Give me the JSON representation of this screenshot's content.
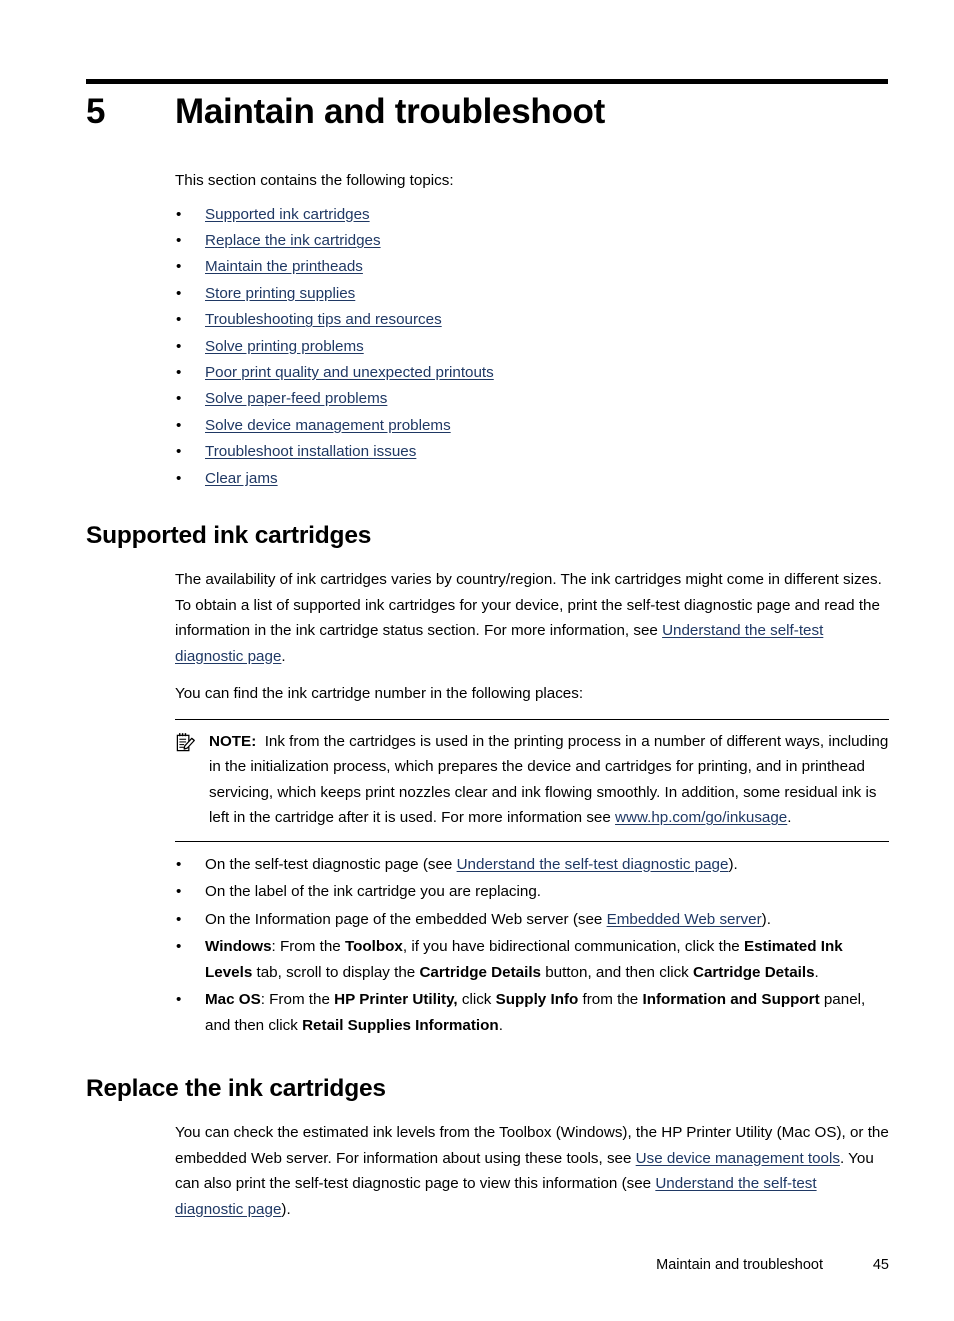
{
  "chapter": {
    "number": "5",
    "title": "Maintain and troubleshoot",
    "intro": "This section contains the following topics:"
  },
  "toc": {
    "bullet": "•",
    "items": [
      {
        "label": "Supported ink cartridges"
      },
      {
        "label": "Replace the ink cartridges"
      },
      {
        "label": "Maintain the printheads"
      },
      {
        "label": "Store printing supplies"
      },
      {
        "label": "Troubleshooting tips and resources"
      },
      {
        "label": "Solve printing problems"
      },
      {
        "label": "Poor print quality and unexpected printouts"
      },
      {
        "label": "Solve paper-feed problems"
      },
      {
        "label": "Solve device management problems"
      },
      {
        "label": "Troubleshoot installation issues"
      },
      {
        "label": "Clear jams"
      }
    ]
  },
  "section_supported": {
    "heading": "Supported ink cartridges",
    "para1_before": "The availability of ink cartridges varies by country/region. The ink cartridges might come in different sizes. To obtain a list of supported ink cartridges for your device, print the self-test diagnostic page and read the information in the ink cartridge status section. For more information, see ",
    "para1_link": "Understand the self-test diagnostic page",
    "para1_after": ".",
    "para2": "You can find the ink cartridge number in the following places:",
    "note": {
      "icon": "note-pencil-icon",
      "label": "NOTE:",
      "text_before": "Ink from the cartridges is used in the printing process in a number of different ways, including in the initialization process, which prepares the device and cartridges for printing, and in printhead servicing, which keeps print nozzles clear and ink flowing smoothly. In addition, some residual ink is left in the cartridge after it is used. For more information see ",
      "link": "www.hp.com/go/inkusage",
      "text_after": "."
    },
    "places": [
      {
        "seg1": "On the self-test diagnostic page (see ",
        "link": "Understand the self-test diagnostic page",
        "seg2": ")."
      },
      {
        "seg1": "On the label of the ink cartridge you are replacing.",
        "link": "",
        "seg2": ""
      },
      {
        "seg1": "On the Information page of the embedded Web server (see ",
        "link": "Embedded Web server",
        "seg2": ")."
      }
    ],
    "windows_bullet": {
      "b1": "Windows",
      "t1": ": From the ",
      "b2": "Toolbox",
      "t2": ", if you have bidirectional communication, click the ",
      "b3": "Estimated Ink Levels",
      "t3": " tab, scroll to display the ",
      "b4": "Cartridge Details",
      "t4": " button, and then click ",
      "b5": "Cartridge Details",
      "t5": "."
    },
    "mac_bullet": {
      "b1": "Mac OS",
      "t1": ": From the ",
      "b2": "HP Printer Utility,",
      "t2": " click ",
      "b3": "Supply Info",
      "t3": " from the ",
      "b4": "Information and Support",
      "t4": " panel, and then click ",
      "b5": "Retail Supplies Information",
      "t5": "."
    }
  },
  "section_replace": {
    "heading": "Replace the ink cartridges",
    "para_seg1": "You can check the estimated ink levels from the Toolbox (Windows), the HP Printer Utility (Mac OS), or the embedded Web server. For information about using these tools, see ",
    "para_link1": "Use device management tools",
    "para_seg2": ". You can also print the self-test diagnostic page to view this information (see ",
    "para_link2": "Understand the self-test diagnostic page",
    "para_seg3": ")."
  },
  "footer": {
    "title": "Maintain and troubleshoot",
    "page_number": "45"
  },
  "colors": {
    "link": "#1F3864",
    "text": "#000000",
    "rule": "#000000",
    "background": "#FFFFFF"
  }
}
